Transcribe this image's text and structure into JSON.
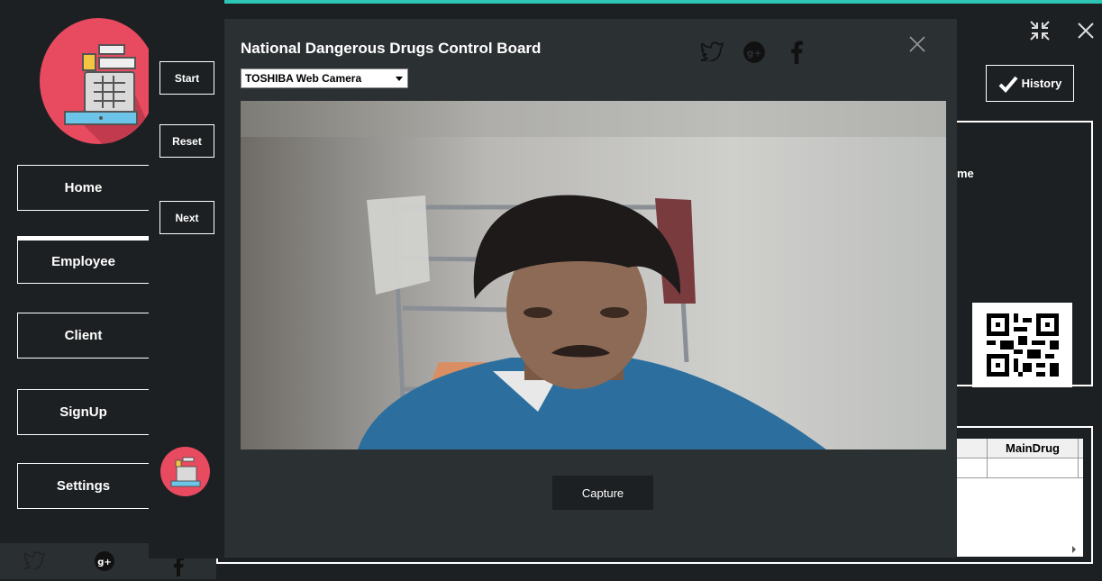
{
  "colors": {
    "accent": "#2ec4b6",
    "brand": "#e84a5f",
    "background": "#1d2022",
    "modal": "#2b3033"
  },
  "sidebar": {
    "items": [
      {
        "label": "Home"
      },
      {
        "label": "Employee"
      },
      {
        "label": "Client"
      },
      {
        "label": "SignUp"
      },
      {
        "label": "Settings"
      }
    ]
  },
  "steps": {
    "start": "Start",
    "reset": "Reset",
    "next": "Next"
  },
  "background_app": {
    "history_label": "History",
    "partial_label": "me",
    "grid_column": "MainDrug"
  },
  "modal": {
    "title": "National Dangerous Drugs Control Board",
    "camera_selected": "TOSHIBA Web Camera",
    "capture_label": "Capture",
    "social_icons": [
      "twitter-icon",
      "google-plus-icon",
      "facebook-icon"
    ]
  }
}
